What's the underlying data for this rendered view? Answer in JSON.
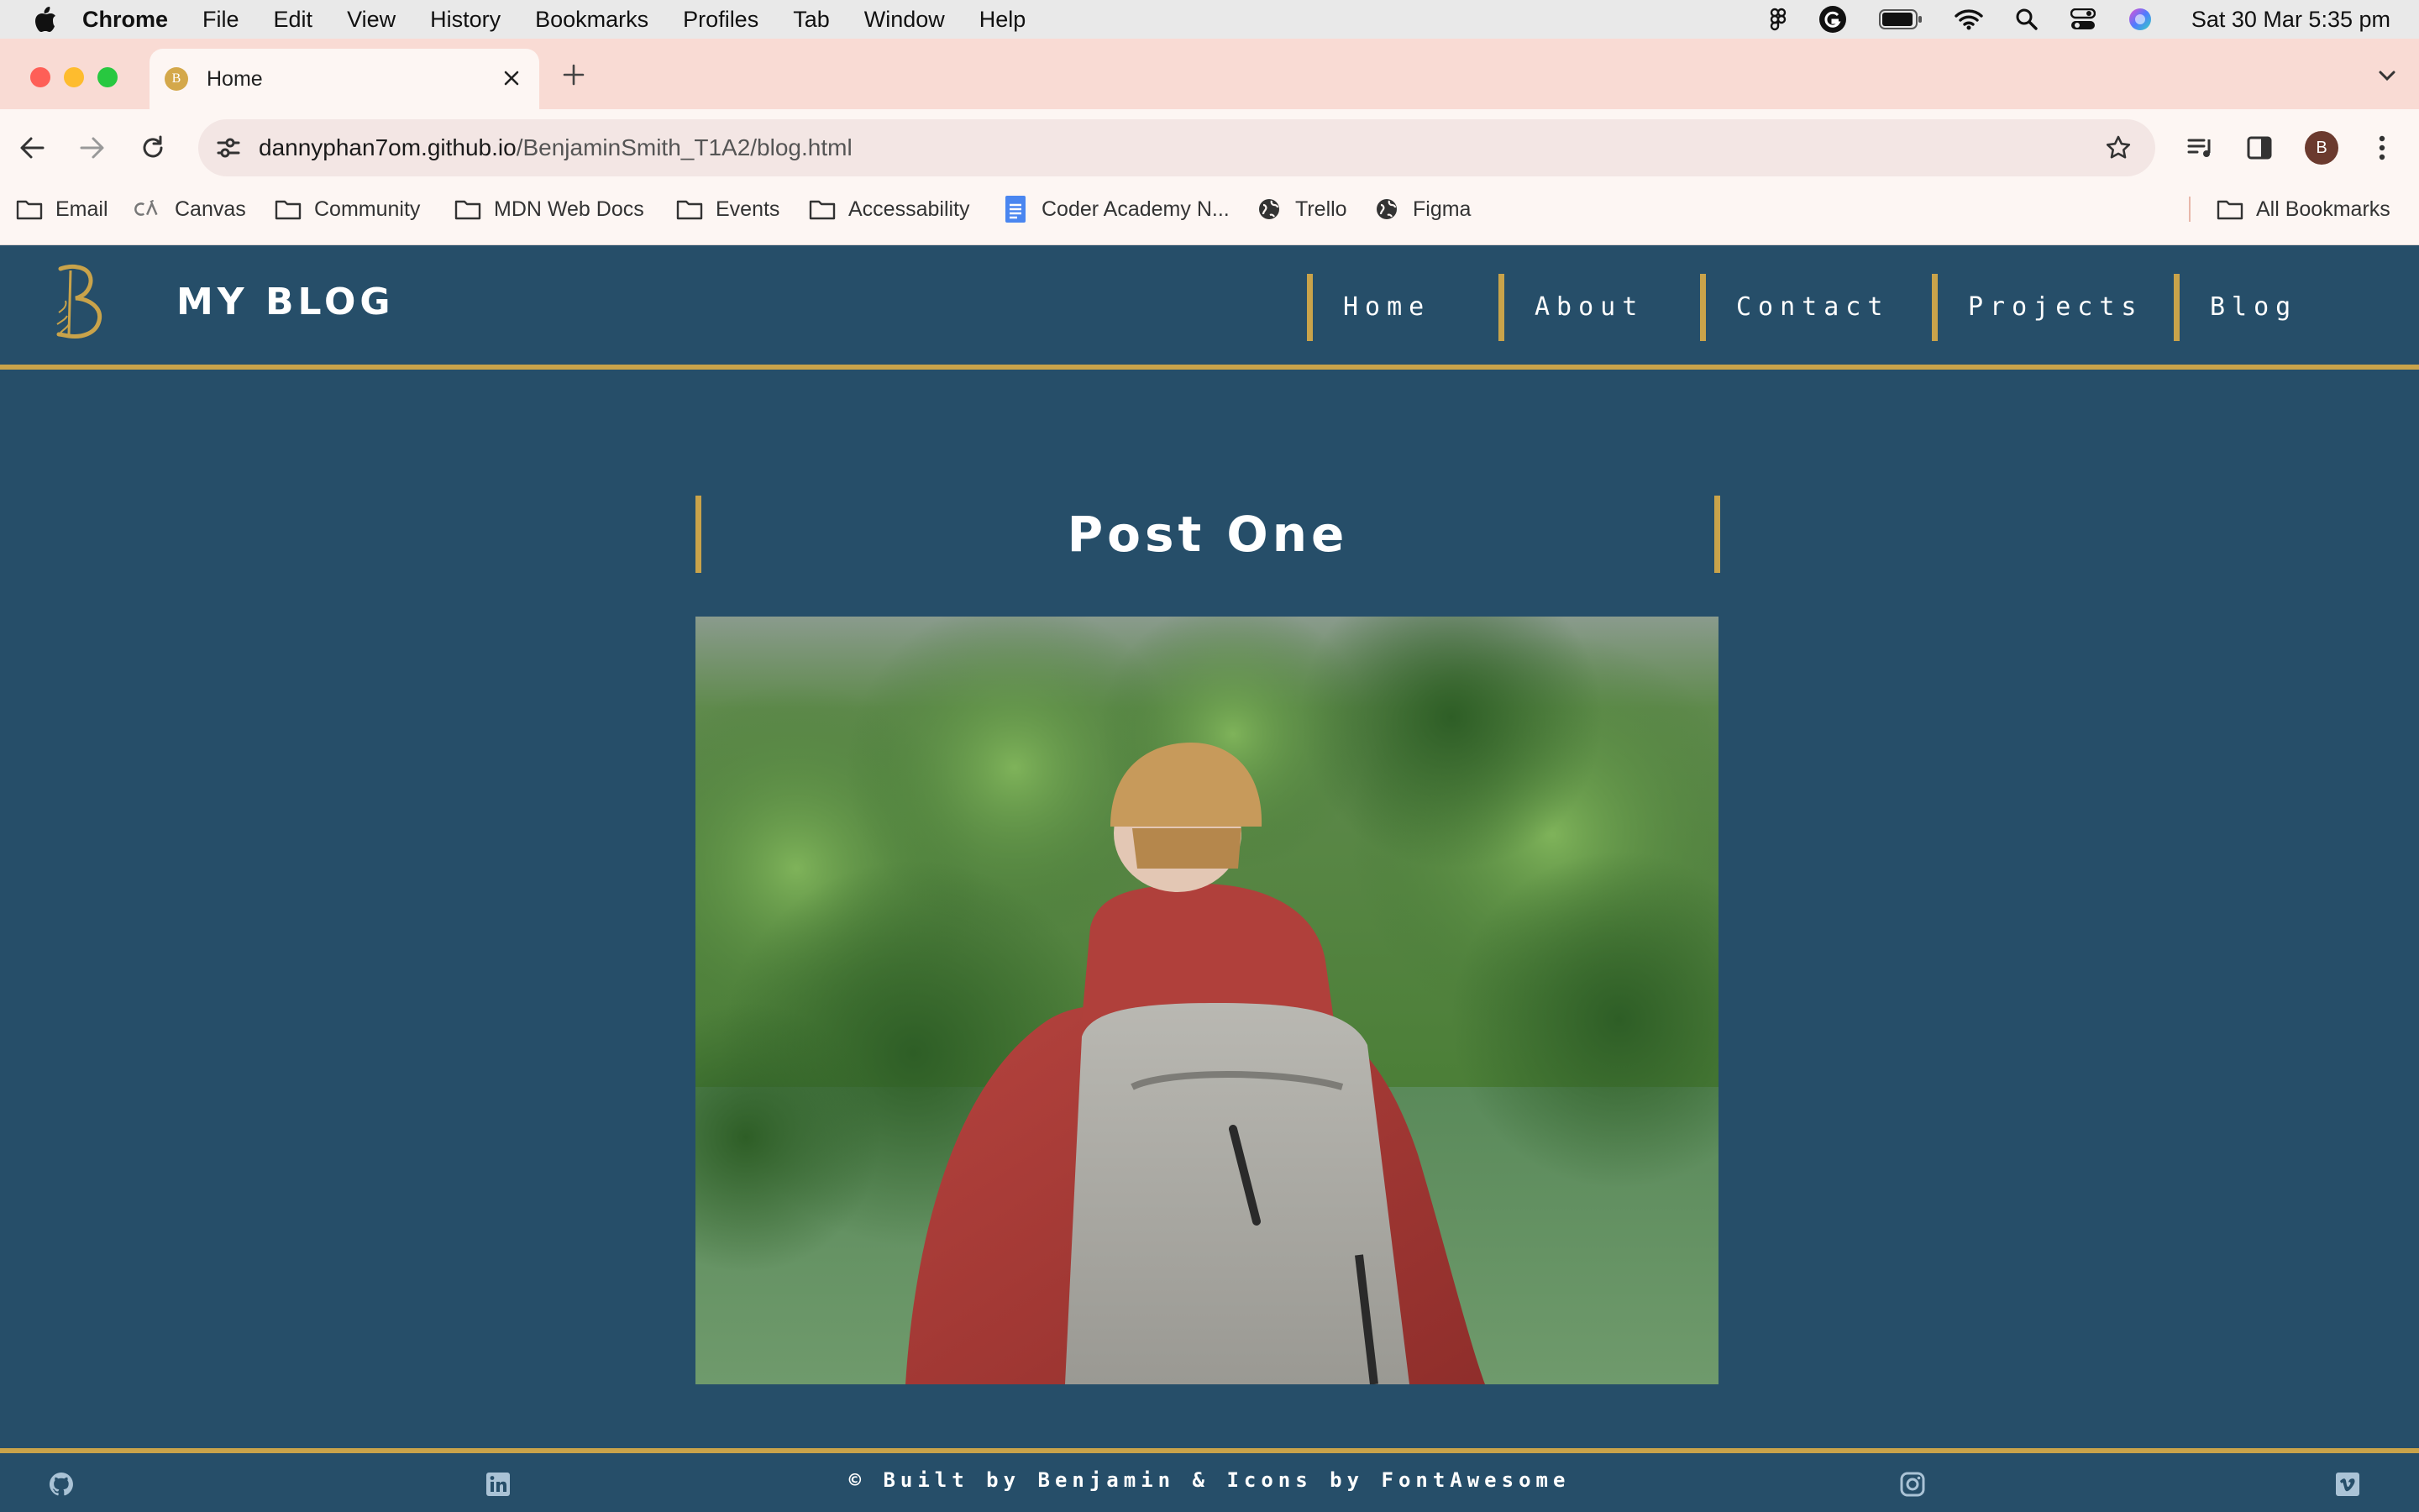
{
  "menubar": {
    "app_name": "Chrome",
    "items": [
      "File",
      "Edit",
      "View",
      "History",
      "Bookmarks",
      "Profiles",
      "Tab",
      "Window",
      "Help"
    ],
    "clock": "Sat 30 Mar  5:35 pm"
  },
  "tabs": {
    "active_title": "Home",
    "favicon_letter": "B"
  },
  "toolbar": {
    "url_host": "dannyphan7om.github.io",
    "url_path": "/BenjaminSmith_T1A2/blog.html",
    "profile_initial": "B"
  },
  "bookmarks": {
    "items": [
      "Email",
      "Canvas",
      "Community",
      "MDN Web Docs",
      "Events",
      "Accessability",
      "Coder Academy N...",
      "Trello",
      "Figma"
    ],
    "all_label": "All Bookmarks"
  },
  "site": {
    "title": "MY BLOG",
    "nav": [
      "Home",
      "About",
      "Contact",
      "Projects",
      "Blog"
    ],
    "accent": "#c9a34a",
    "background": "#264e69"
  },
  "post": {
    "title": "Post One"
  },
  "footer": {
    "text": "© Built by Benjamin & Icons by FontAwesome",
    "icons": [
      "github-icon",
      "linkedin-icon",
      "instagram-icon",
      "vimeo-icon"
    ]
  }
}
